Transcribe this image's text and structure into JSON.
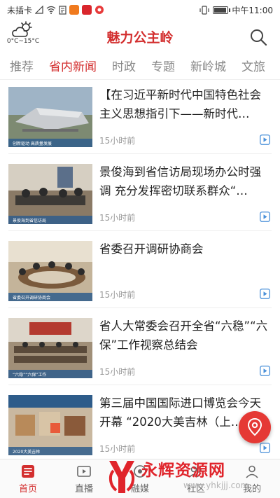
{
  "status_bar": {
    "carrier": "未插卡",
    "time": "中午11:00",
    "battery_level": 0.85
  },
  "header": {
    "weather_temp": "0°C~15°C",
    "title": "魅力公主岭"
  },
  "tabs": [
    {
      "label": "推荐",
      "active": false
    },
    {
      "label": "省内新闻",
      "active": true
    },
    {
      "label": "时政",
      "active": false
    },
    {
      "label": "专题",
      "active": false
    },
    {
      "label": "新岭城",
      "active": false
    },
    {
      "label": "文旅",
      "active": false
    }
  ],
  "news": [
    {
      "title": "【在习近平新时代中国特色社会主义思想指引下——新时代…",
      "time": "15小时前",
      "caption": "创新驱动 高质量发展"
    },
    {
      "title": "景俊海到省信访局现场办公时强调 充分发挥密切联系群众“…",
      "time": "15小时前",
      "caption": "景俊海到省信访局"
    },
    {
      "title": "省委召开调研协商会",
      "time": "15小时前",
      "caption": "省委召开调研协商会"
    },
    {
      "title": "省人大常委会召开全省“六稳”“六保”工作视察总结会",
      "time": "15小时前",
      "caption": "“六稳”“六保”工作"
    },
    {
      "title": "第三届中国国际进口博览会今天开幕 “2020大美吉林（上…",
      "time": "15小时前",
      "caption": "2020大美吉林"
    }
  ],
  "bottom_nav": [
    {
      "label": "首页",
      "active": true
    },
    {
      "label": "直播",
      "active": false
    },
    {
      "label": "融媒",
      "active": false
    },
    {
      "label": "社区",
      "active": false
    },
    {
      "label": "我的",
      "active": false
    }
  ],
  "watermark": {
    "text": "永辉资源网",
    "url": "www.yhkjjj.com"
  },
  "colors": {
    "accent": "#d32f2f",
    "tab_inactive": "#888888",
    "time_text": "#999999"
  }
}
